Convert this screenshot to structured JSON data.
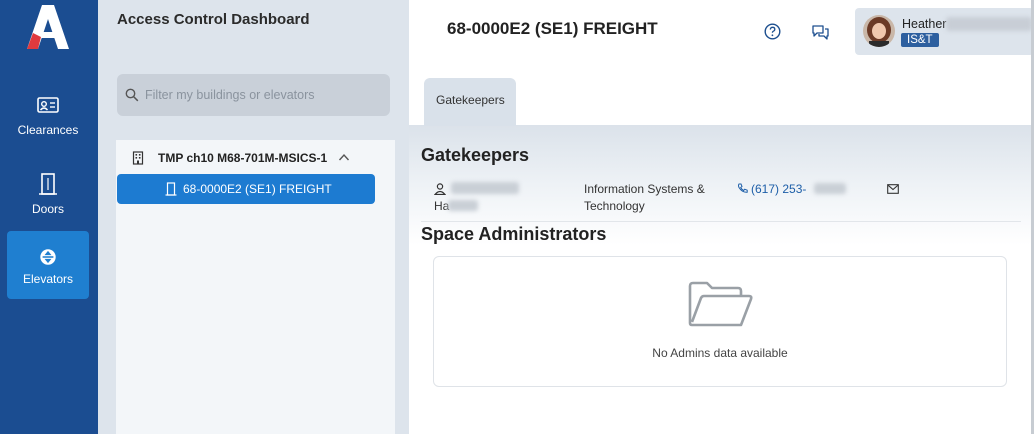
{
  "app": {
    "logo_text": "A"
  },
  "nav": {
    "items": [
      {
        "label": "Clearances",
        "icon": "id-card-icon"
      },
      {
        "label": "Doors",
        "icon": "door-icon"
      },
      {
        "label": "Elevators",
        "icon": "elevator-icon",
        "active": true
      }
    ]
  },
  "panel": {
    "title": "Access Control Dashboard",
    "filter_placeholder": "Filter my buildings or elevators",
    "building_label": "TMP ch10 M68-701M-MSICS-1",
    "elevator_label": "68-0000E2 (SE1) FREIGHT"
  },
  "header": {
    "title": "68-0000E2 (SE1) FREIGHT",
    "user_first_name": "Heather",
    "user_badge": "IS&T"
  },
  "tabs": [
    {
      "label": "Gatekeepers",
      "active": true
    }
  ],
  "gatekeepers": {
    "heading": "Gatekeepers",
    "rows": [
      {
        "name_prefix": "Ha",
        "department": "Information Systems & Technology",
        "phone": "(617) 253-"
      }
    ]
  },
  "space_admins": {
    "heading": "Space Administrators",
    "empty_text": "No Admins data available"
  },
  "colors": {
    "rail": "#1b4d91",
    "accent": "#1d7bd1",
    "panel_bg": "#dde4ec",
    "badge": "#2d5f9f"
  }
}
